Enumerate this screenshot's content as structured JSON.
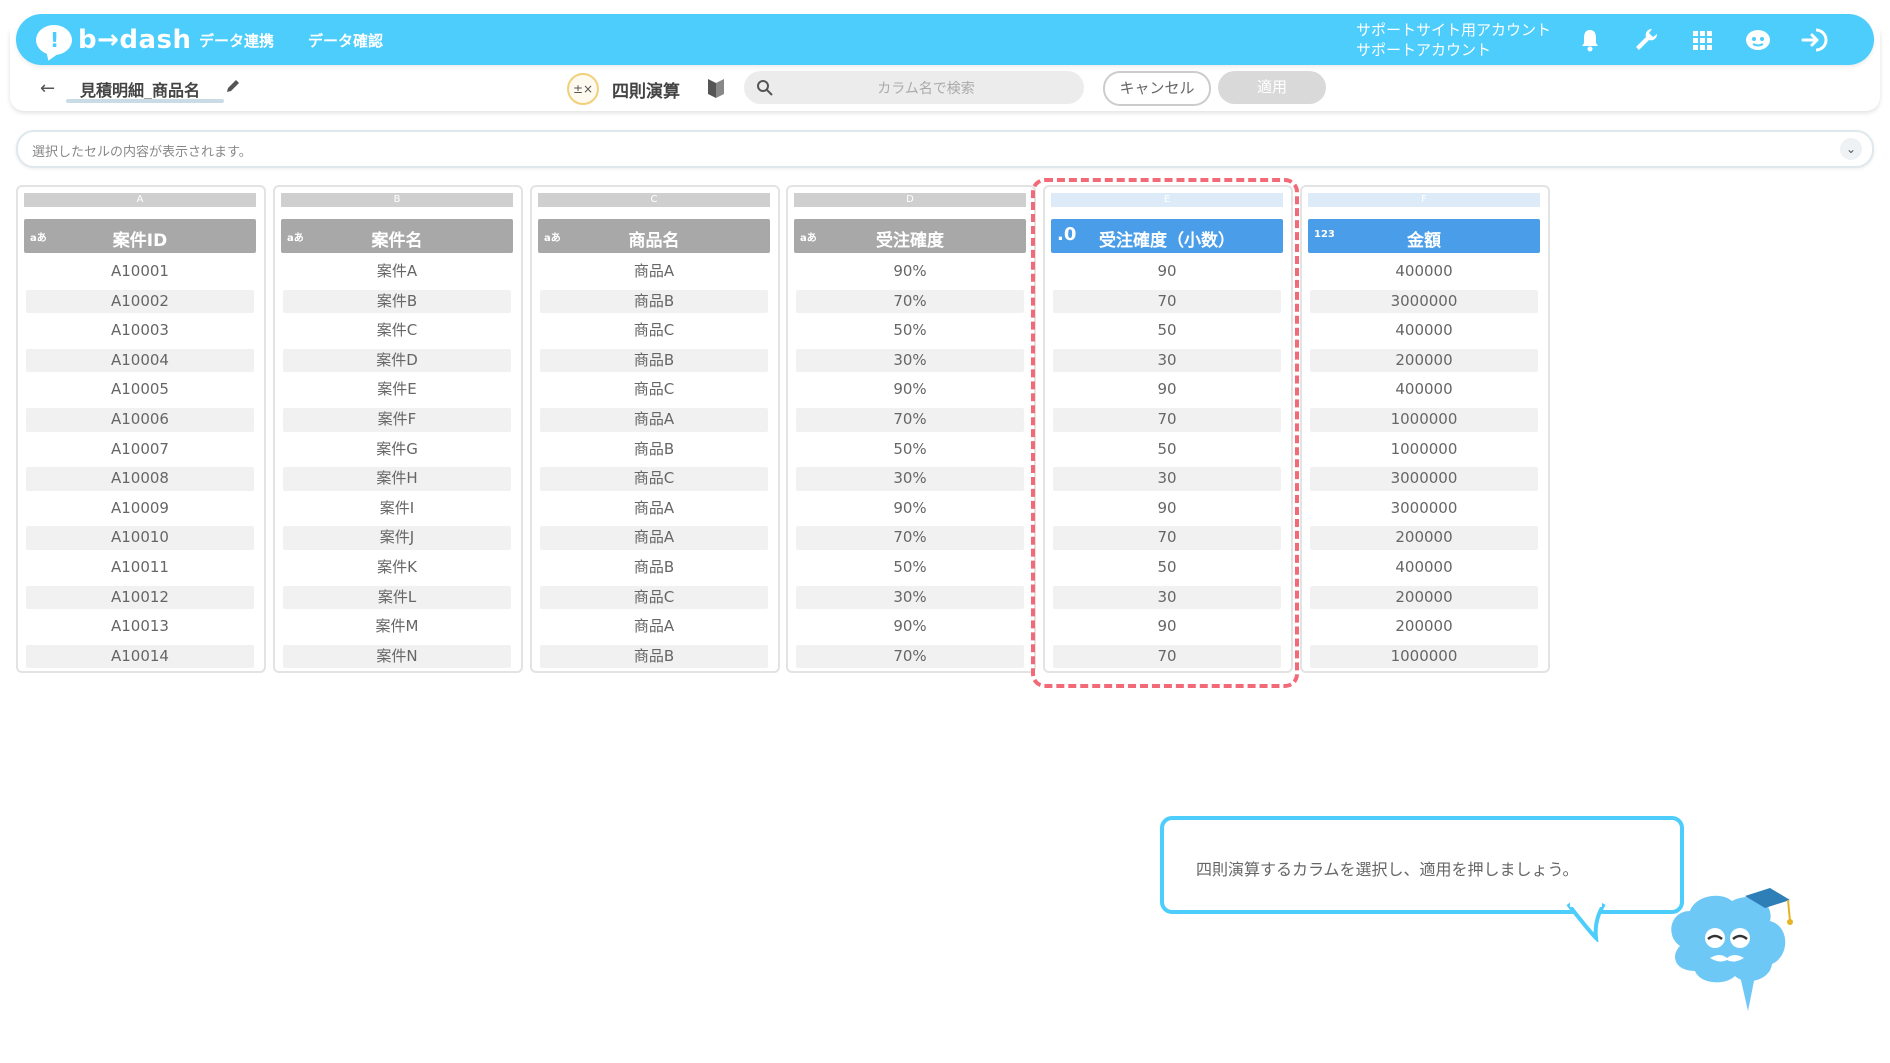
{
  "header": {
    "logo_text": "b→dash",
    "nav": [
      "データ連携",
      "データ確認"
    ],
    "account_line1": "サポートサイト用アカウント",
    "account_line2": "サポートアカウント"
  },
  "toolbar": {
    "table_name": "見積明細_商品名",
    "operation_title": "四則演算",
    "search_placeholder": "カラム名で検索",
    "cancel_label": "キャンセル",
    "apply_label": "適用"
  },
  "cell_bar": {
    "placeholder": "選択したセルの内容が表示されます。"
  },
  "columns": [
    {
      "letter": "A",
      "type": "aあ",
      "name": "案件ID",
      "selected": false,
      "rows": [
        "A10001",
        "A10002",
        "A10003",
        "A10004",
        "A10005",
        "A10006",
        "A10007",
        "A10008",
        "A10009",
        "A10010",
        "A10011",
        "A10012",
        "A10013",
        "A10014"
      ]
    },
    {
      "letter": "B",
      "type": "aあ",
      "name": "案件名",
      "selected": false,
      "rows": [
        "案件A",
        "案件B",
        "案件C",
        "案件D",
        "案件E",
        "案件F",
        "案件G",
        "案件H",
        "案件I",
        "案件J",
        "案件K",
        "案件L",
        "案件M",
        "案件N"
      ]
    },
    {
      "letter": "C",
      "type": "aあ",
      "name": "商品名",
      "selected": false,
      "rows": [
        "商品A",
        "商品B",
        "商品C",
        "商品B",
        "商品C",
        "商品A",
        "商品B",
        "商品C",
        "商品A",
        "商品A",
        "商品B",
        "商品C",
        "商品A",
        "商品B"
      ]
    },
    {
      "letter": "D",
      "type": "aあ",
      "name": "受注確度",
      "selected": false,
      "rows": [
        "90%",
        "70%",
        "50%",
        "30%",
        "90%",
        "70%",
        "50%",
        "30%",
        "90%",
        "70%",
        "50%",
        "30%",
        "90%",
        "70%"
      ]
    },
    {
      "letter": "E",
      "type": ".0",
      "name": "受注確度（小数）",
      "selected": true,
      "rows": [
        "90",
        "70",
        "50",
        "30",
        "90",
        "70",
        "50",
        "30",
        "90",
        "70",
        "50",
        "30",
        "90",
        "70"
      ]
    },
    {
      "letter": "F",
      "type": "123",
      "name": "金額",
      "selected": true,
      "rows": [
        "400000",
        "3000000",
        "400000",
        "200000",
        "400000",
        "1000000",
        "1000000",
        "3000000",
        "3000000",
        "200000",
        "400000",
        "200000",
        "200000",
        "1000000"
      ]
    }
  ],
  "tooltip": {
    "message": "四則演算するカラムを選択し、適用を押しましょう。"
  },
  "colors": {
    "header_blue": "#4ccdfc",
    "selected_header": "#4a9de8",
    "highlight_dash": "#f26a78"
  }
}
